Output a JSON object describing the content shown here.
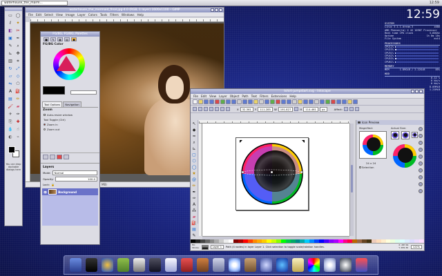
{
  "top_panel": {
    "task_label": "waterhouse_the_marm...",
    "clock": "12:59"
  },
  "conky": {
    "time": "12:59",
    "system": {
      "title": "SYSTEM",
      "rows": [
        {
          "k": "Linux 3.1.1-dream-3",
          "v": "i686"
        },
        {
          "k": "AMD Phenom(tm) X 4X 1090T Processor",
          "v": ""
        },
        {
          "k": "Real time CPU clock",
          "v": "3.60GHz"
        },
        {
          "k": "Uptime",
          "v": "1h 8m 18s"
        },
        {
          "k": "File System",
          "v": "ext4"
        }
      ]
    },
    "processors": {
      "title": "PROCESSORS",
      "rows": [
        {
          "k": "CPU1",
          "v": "2%",
          "level": 0.02
        },
        {
          "k": "CPU2",
          "v": "3%",
          "level": 0.03
        },
        {
          "k": "CPU3",
          "v": "1%",
          "level": 0.01
        },
        {
          "k": "CPU4",
          "v": "2%",
          "level": 0.02
        },
        {
          "k": "CPU5",
          "v": "3%",
          "level": 0.03
        },
        {
          "k": "CPU6",
          "v": "1%",
          "level": 0.01
        }
      ]
    },
    "memory": {
      "title": "MEMORY",
      "rows": [
        {
          "k": "MEM",
          "v": "1.89GiB / 2.22GiB",
          "pct": "85%"
        }
      ]
    },
    "hdd": {
      "title": "HDD"
    },
    "network": {
      "rows": [
        {
          "k": "",
          "v": "0.12 %"
        },
        {
          "k": "",
          "v": "0 kb/s"
        },
        {
          "k": "",
          "v": "0 kb/s"
        },
        {
          "k": "",
          "v": "8.09MiB"
        },
        {
          "k": "",
          "v": "1.21MiB"
        }
      ]
    }
  },
  "gimp_toolbox": {
    "drop_hint": "You can drop dockable dialogs here"
  },
  "gimp_image": {
    "title": "waterhouse_the_mermaid_final.jpg-4.0 (RGB, 1 layer) 1600x1100 – GIMP",
    "menu": [
      "File",
      "Edit",
      "Select",
      "View",
      "Image",
      "Layer",
      "Colors",
      "Tools",
      "Filters",
      "Windows",
      "Help"
    ],
    "status": "MB)"
  },
  "gimp_dock": {
    "title": "FG/BG, FG/BG, Palettes",
    "fgbg_title": "FG/BG Color",
    "tabs": [
      "Tool Options",
      "Navigation"
    ],
    "zoom_title": "Zoom",
    "zoom_options": {
      "auto_resize": "Auto-resize window",
      "toggle_label": "Tool Toggle  (Ctrl)",
      "zoom_in": "Zoom in",
      "zoom_out": "Zoom out"
    },
    "layers": {
      "title": "Layers",
      "mode_label": "Mode:",
      "mode_value": "Normal",
      "opacity_label": "Opacity:",
      "opacity_value": "100.0",
      "lock_label": "Lock:",
      "layer_name": "Background"
    }
  },
  "inkscape": {
    "title": "tshirt-jumpstart.svg - Inkscape",
    "menu": [
      "File",
      "Edit",
      "View",
      "Layer",
      "Object",
      "Path",
      "Text",
      "Filters",
      "Extensions",
      "Help"
    ],
    "ctrl": {
      "x": "32.361",
      "y": "111.285",
      "w": "191.827",
      "h": "114.461",
      "unit": "px",
      "affect": "Affect:"
    },
    "status": {
      "fill_label": "Fill:",
      "stroke_label": "Stroke:",
      "fill_color": "#7a7a7a",
      "stroke_color": "#1a1a1a",
      "layer": "Layer 1",
      "message": "Path (4 nodes) in layer Layer 1. Click selection to toggle scale/rotation handles.",
      "coords_x": "X: 287.61",
      "coords_y": "Y: 455.36",
      "zoom": "122%"
    },
    "icon_preview": {
      "title": "Icon Preview",
      "magnified": "Magnified:",
      "actual_size": "Actual Size:",
      "size_label": "24 x 24",
      "selection": "Selection"
    }
  }
}
